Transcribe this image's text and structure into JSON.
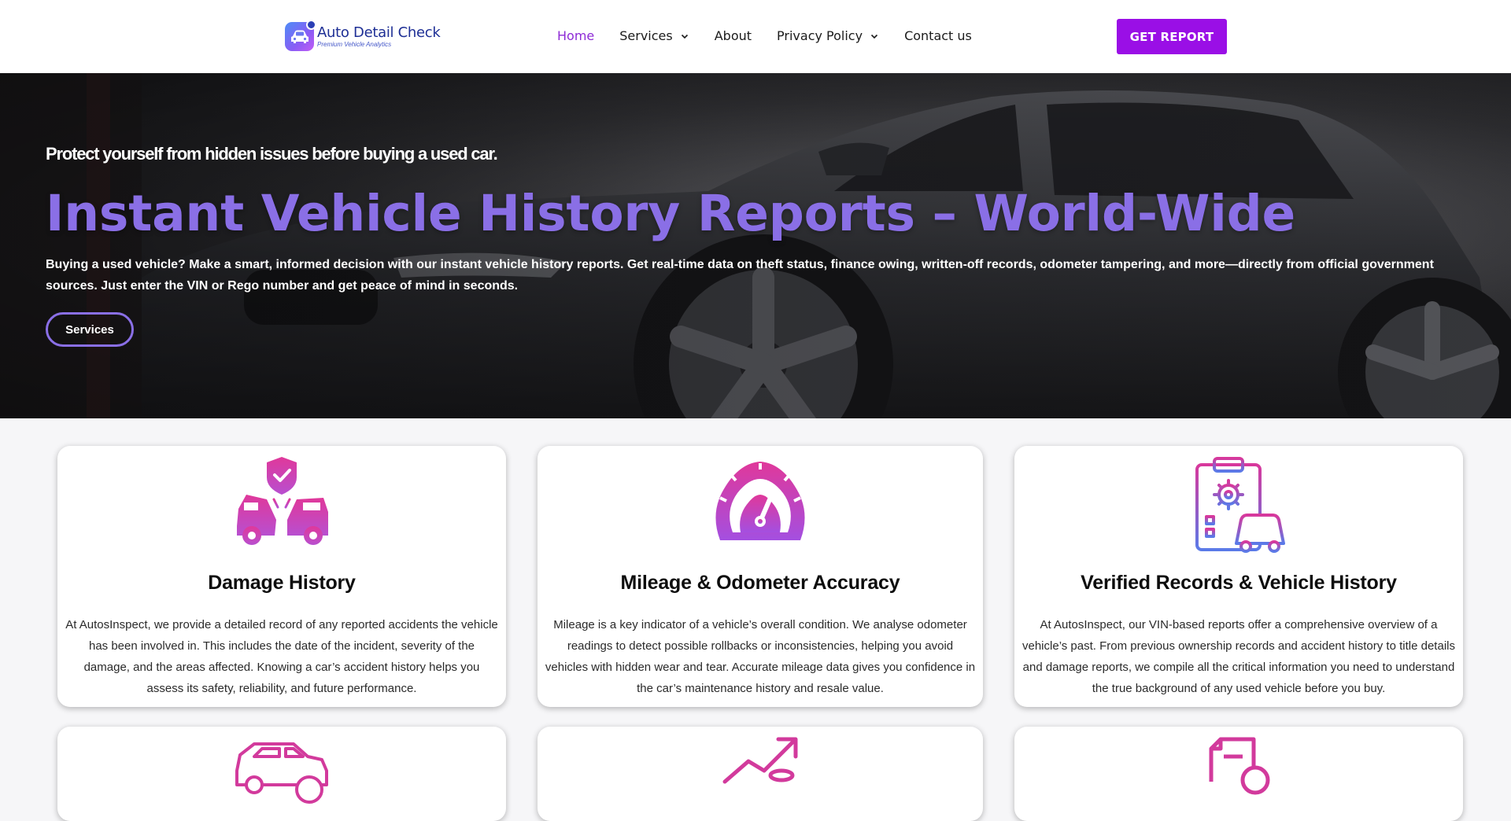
{
  "brand": {
    "title": "Auto Detail Check",
    "tagline": "Premium Vehicle Analytics",
    "accent": "#9a0fe6",
    "hero_title_color": "#8a6fe6",
    "icon_pink": "#d23a9c"
  },
  "nav": {
    "items": [
      {
        "label": "Home",
        "active": true,
        "dropdown": false
      },
      {
        "label": "Services",
        "active": false,
        "dropdown": true
      },
      {
        "label": "About",
        "active": false,
        "dropdown": false
      },
      {
        "label": "Privacy Policy",
        "active": false,
        "dropdown": true
      },
      {
        "label": "Contact us",
        "active": false,
        "dropdown": false
      }
    ],
    "cta_label": "GET REPORT"
  },
  "hero": {
    "kicker": "Protect yourself from hidden issues before buying a used car.",
    "title": "Instant Vehicle History Reports – World-Wide",
    "description": "Buying a used vehicle? Make a smart, informed decision with our instant vehicle history reports. Get real-time data on theft status, finance owing, written-off records, odometer tampering, and more—directly from official government sources. Just enter the VIN or Rego number and get peace of mind in seconds.",
    "button_label": "Services"
  },
  "cards": [
    {
      "icon": "car-crash-shield-icon",
      "title": "Damage History",
      "text": "At AutosInspect, we provide a detailed record of any reported accidents the vehicle has been involved in. This includes the date of the incident, severity of the damage, and the areas affected. Knowing a car’s accident history helps you assess its safety, reliability, and future performance."
    },
    {
      "icon": "speedometer-icon",
      "title": "Mileage & Odometer Accuracy",
      "text": "Mileage is a key indicator of a vehicle’s overall condition. We analyse odometer readings to detect possible rollbacks or inconsistencies, helping you avoid vehicles with hidden wear and tear. Accurate mileage data gives you confidence in the car’s maintenance history and resale value."
    },
    {
      "icon": "clipboard-car-gear-icon",
      "title": "Verified Records & Vehicle History",
      "text": "At AutosInspect, our VIN-based reports offer a comprehensive overview of a vehicle’s past. From previous ownership records and accident history to title details and damage reports, we compile all the critical information you need to understand the true background of any used vehicle before you buy."
    }
  ],
  "lower_cards": [
    {
      "icon": "car-search-icon"
    },
    {
      "icon": "growth-chart-coins-icon"
    },
    {
      "icon": "document-check-icon"
    }
  ]
}
